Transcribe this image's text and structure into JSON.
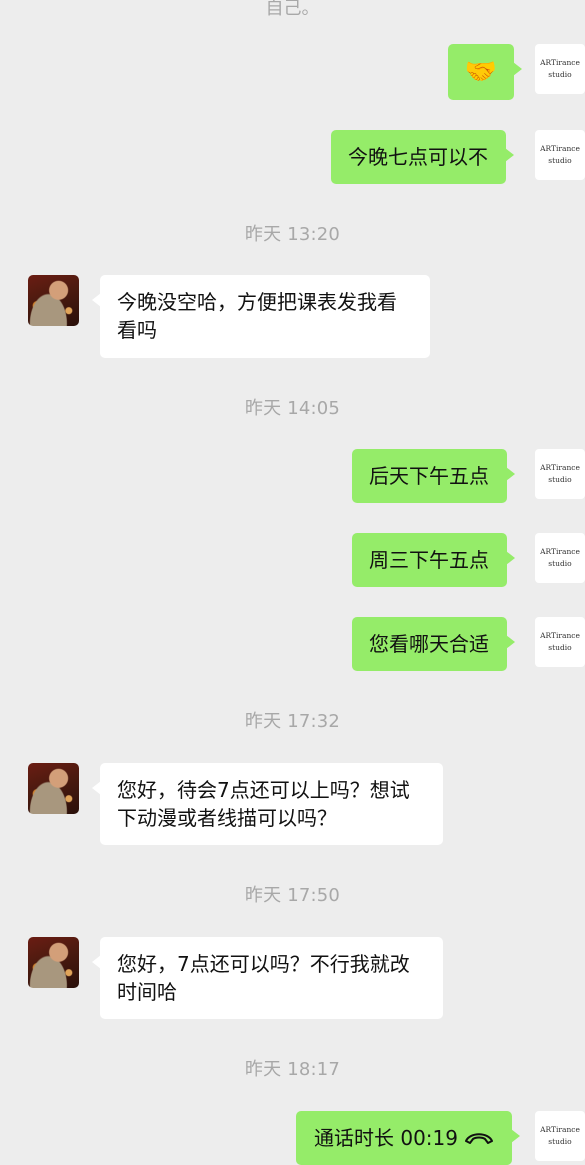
{
  "top_fragment": "自己。",
  "outgoing_avatar": {
    "line1": "ARTirance",
    "line2": "studio"
  },
  "messages": [
    {
      "kind": "emoji",
      "text": "🤝",
      "emoji_name": "handshake-emoji"
    },
    {
      "kind": "text",
      "text": "今晚七点可以不"
    },
    {
      "kind": "timestamp",
      "text": "昨天 13:20"
    },
    {
      "kind": "text",
      "text": "今晚没空哈，方便把课表发我看看吗"
    },
    {
      "kind": "timestamp",
      "text": "昨天 14:05"
    },
    {
      "kind": "text",
      "text": "后天下午五点"
    },
    {
      "kind": "text",
      "text": "周三下午五点"
    },
    {
      "kind": "text",
      "text": "您看哪天合适"
    },
    {
      "kind": "timestamp",
      "text": "昨天 17:32"
    },
    {
      "kind": "text",
      "text": "您好，待会7点还可以上吗？想试下动漫或者线描可以吗？"
    },
    {
      "kind": "timestamp",
      "text": "昨天 17:50"
    },
    {
      "kind": "text",
      "text": "您好，7点还可以吗？不行我就改时间哈"
    },
    {
      "kind": "timestamp",
      "text": "昨天 18:17"
    },
    {
      "kind": "call",
      "text": "通话时长 00:19",
      "icon": "phone-hangup-icon"
    }
  ],
  "colors": {
    "background": "#ededed",
    "outgoing_bubble": "#95ec69",
    "incoming_bubble": "#ffffff",
    "timestamp_text": "#a8a8a8"
  }
}
